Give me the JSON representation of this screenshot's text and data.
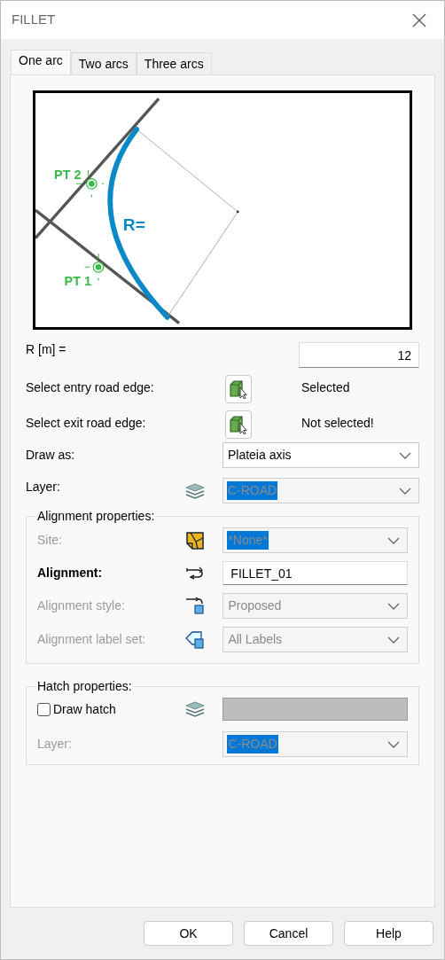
{
  "window": {
    "title": "FILLET"
  },
  "tabs": [
    {
      "label": "One arc",
      "selected": true
    },
    {
      "label": "Two arcs",
      "selected": false
    },
    {
      "label": "Three arcs",
      "selected": false
    }
  ],
  "diagram": {
    "pt2": "PT 2",
    "radius": "R=",
    "pt1": "PT 1"
  },
  "radius": {
    "label": "R [m] =",
    "value": "12"
  },
  "picks": [
    {
      "label": "Select entry road edge:",
      "status": "Selected"
    },
    {
      "label": "Select exit road edge:",
      "status": "Not selected!"
    }
  ],
  "draw_as": {
    "label": "Draw as:",
    "value": "Plateia axis",
    "disabled": false,
    "highlighted": false
  },
  "layer": {
    "label": "Layer:",
    "value": "C-ROAD",
    "disabled": true,
    "highlighted": true
  },
  "alignment_properties": {
    "title": "Alignment properties:",
    "fields": [
      {
        "label": "Site:",
        "kind": "dropdown",
        "value": "*None*",
        "disabled": true,
        "highlighted": true
      },
      {
        "label": "Alignment:",
        "kind": "text",
        "value": "FILLET_01",
        "disabled": false,
        "highlighted": false
      },
      {
        "label": "Alignment style:",
        "kind": "dropdown",
        "value": "Proposed",
        "disabled": true,
        "highlighted": false
      },
      {
        "label": "Alignment label set:",
        "kind": "dropdown",
        "value": "All Labels",
        "disabled": true,
        "highlighted": false
      }
    ]
  },
  "hatch_properties": {
    "title": "Hatch properties:",
    "draw_hatch": {
      "label": "Draw hatch",
      "checked": false
    },
    "layer": {
      "label": "Layer:",
      "value": "C-ROAD",
      "disabled": true,
      "highlighted": true
    }
  },
  "buttons": [
    "OK",
    "Cancel",
    "Help"
  ]
}
